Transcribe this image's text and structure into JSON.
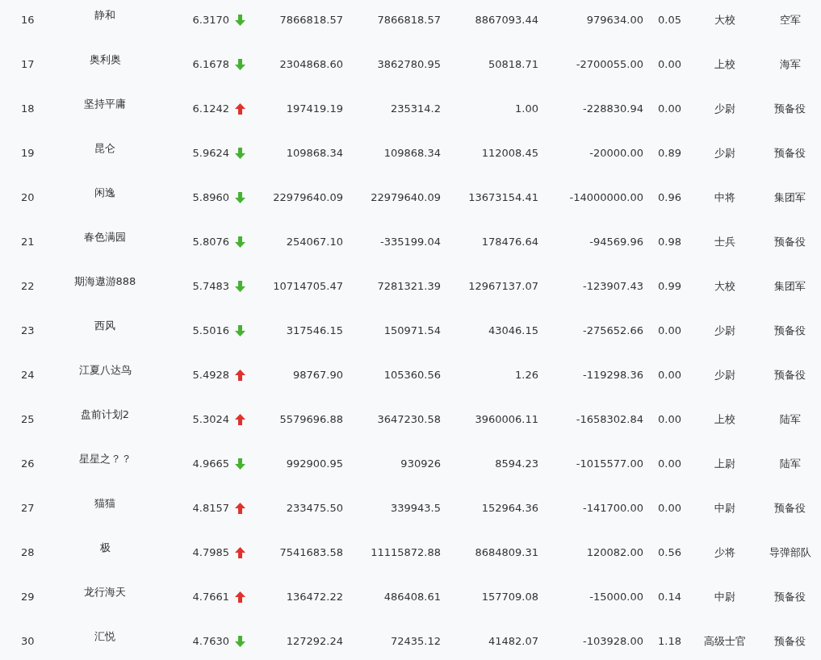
{
  "rows": [
    {
      "rank": "16",
      "name": "静和",
      "score": "6.3170",
      "rising": false,
      "column_3": "7866818.57",
      "column_4": "7866818.57",
      "column_5": "8867093.44",
      "column_6": "979634.00",
      "column_7": "0.05",
      "title": "大校",
      "branch": "空军"
    },
    {
      "rank": "17",
      "name": "奥利奥",
      "score": "6.1678",
      "rising": false,
      "column_3": "2304868.60",
      "column_4": "3862780.95",
      "column_5": "50818.71",
      "column_6": "-2700055.00",
      "column_7": "0.00",
      "title": "上校",
      "branch": "海军"
    },
    {
      "rank": "18",
      "name": "坚持平庸",
      "score": "6.1242",
      "rising": true,
      "column_3": "197419.19",
      "column_4": "235314.2",
      "column_5": "1.00",
      "column_6": "-228830.94",
      "column_7": "0.00",
      "title": "少尉",
      "branch": "预备役"
    },
    {
      "rank": "19",
      "name": "昆仑",
      "score": "5.9624",
      "rising": false,
      "column_3": "109868.34",
      "column_4": "109868.34",
      "column_5": "112008.45",
      "column_6": "-20000.00",
      "column_7": "0.89",
      "title": "少尉",
      "branch": "预备役"
    },
    {
      "rank": "20",
      "name": "闲逸",
      "score": "5.8960",
      "rising": false,
      "column_3": "22979640.09",
      "column_4": "22979640.09",
      "column_5": "13673154.41",
      "column_6": "-14000000.00",
      "column_7": "0.96",
      "title": "中将",
      "branch": "集团军"
    },
    {
      "rank": "21",
      "name": "春色满园",
      "score": "5.8076",
      "rising": false,
      "column_3": "254067.10",
      "column_4": "-335199.04",
      "column_5": "178476.64",
      "column_6": "-94569.96",
      "column_7": "0.98",
      "title": "士兵",
      "branch": "预备役"
    },
    {
      "rank": "22",
      "name": "期海遨游888",
      "score": "5.7483",
      "rising": false,
      "column_3": "10714705.47",
      "column_4": "7281321.39",
      "column_5": "12967137.07",
      "column_6": "-123907.43",
      "column_7": "0.99",
      "title": "大校",
      "branch": "集团军"
    },
    {
      "rank": "23",
      "name": "西风",
      "score": "5.5016",
      "rising": false,
      "column_3": "317546.15",
      "column_4": "150971.54",
      "column_5": "43046.15",
      "column_6": "-275652.66",
      "column_7": "0.00",
      "title": "少尉",
      "branch": "预备役"
    },
    {
      "rank": "24",
      "name": "江夏八达鸟",
      "score": "5.4928",
      "rising": true,
      "column_3": "98767.90",
      "column_4": "105360.56",
      "column_5": "1.26",
      "column_6": "-119298.36",
      "column_7": "0.00",
      "title": "少尉",
      "branch": "预备役"
    },
    {
      "rank": "25",
      "name": "盘前计划2",
      "score": "5.3024",
      "rising": true,
      "column_3": "5579696.88",
      "column_4": "3647230.58",
      "column_5": "3960006.11",
      "column_6": "-1658302.84",
      "column_7": "0.00",
      "title": "上校",
      "branch": "陆军"
    },
    {
      "rank": "26",
      "name": "星星之？？",
      "score": "4.9665",
      "rising": false,
      "column_3": "992900.95",
      "column_4": "930926",
      "column_5": "8594.23",
      "column_6": "-1015577.00",
      "column_7": "0.00",
      "title": "上尉",
      "branch": "陆军"
    },
    {
      "rank": "27",
      "name": "猫猫",
      "score": "4.8157",
      "rising": true,
      "column_3": "233475.50",
      "column_4": "339943.5",
      "column_5": "152964.36",
      "column_6": "-141700.00",
      "column_7": "0.00",
      "title": "中尉",
      "branch": "预备役"
    },
    {
      "rank": "28",
      "name": "极",
      "score": "4.7985",
      "rising": true,
      "column_3": "7541683.58",
      "column_4": "11115872.88",
      "column_5": "8684809.31",
      "column_6": "120082.00",
      "column_7": "0.56",
      "title": "少将",
      "branch": "导弹部队"
    },
    {
      "rank": "29",
      "name": "龙行海天",
      "score": "4.7661",
      "rising": true,
      "column_3": "136472.22",
      "column_4": "486408.61",
      "column_5": "157709.08",
      "column_6": "-15000.00",
      "column_7": "0.14",
      "title": "中尉",
      "branch": "预备役"
    },
    {
      "rank": "30",
      "name": "汇悦",
      "score": "4.7630",
      "rising": false,
      "column_3": "127292.24",
      "column_4": "72435.12",
      "column_5": "41482.07",
      "column_6": "-103928.00",
      "column_7": "1.18",
      "title": "高级士官",
      "branch": "预备役"
    }
  ]
}
